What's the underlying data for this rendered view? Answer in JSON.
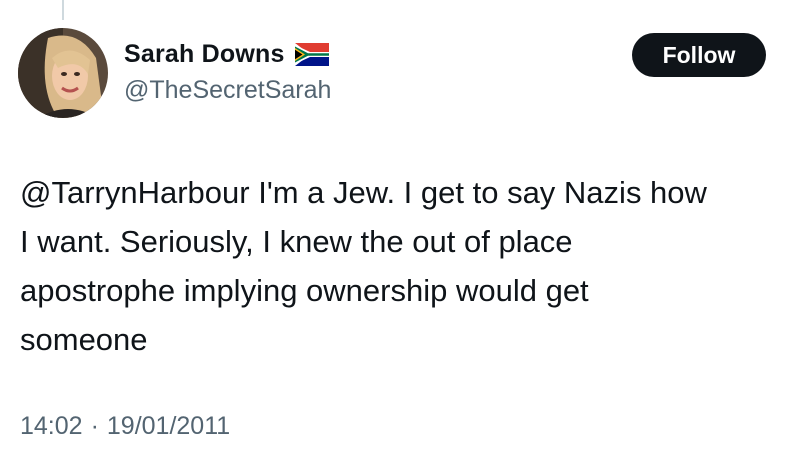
{
  "tweet": {
    "author": {
      "display_name": "Sarah Downs",
      "handle": "@TheSecretSarah",
      "flag_icon": "south-africa-flag-icon"
    },
    "follow_label": "Follow",
    "text_lines": [
      "@TarrynHarbour I'm a Jew. I get to say Nazis how",
      "I want. Seriously, I knew the out of place",
      "apostrophe implying ownership would get",
      "someone"
    ],
    "time": "14:02",
    "separator": "·",
    "date": "19/01/2011"
  },
  "colors": {
    "text_primary": "#0f1419",
    "text_secondary": "#536471",
    "button_bg": "#0f1419",
    "button_text": "#ffffff"
  }
}
